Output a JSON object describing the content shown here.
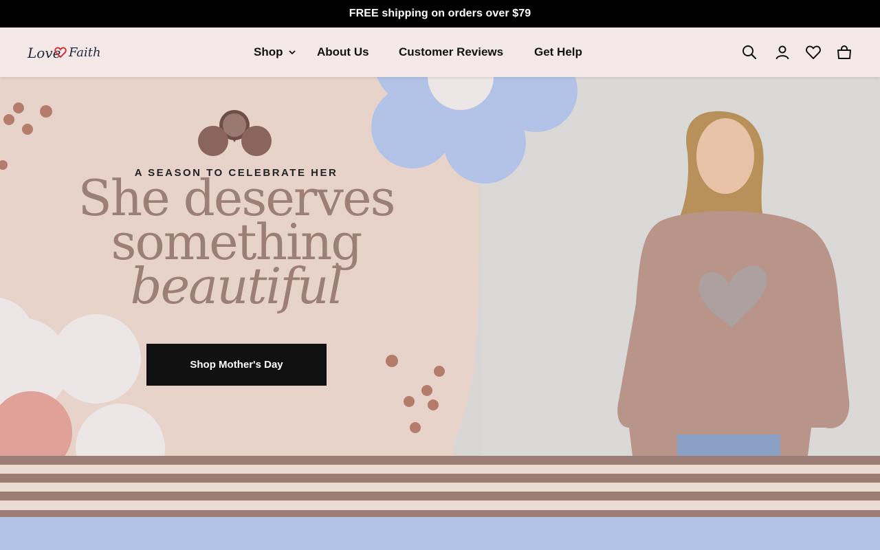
{
  "announcement": {
    "text": "FREE shipping on orders over $79"
  },
  "header": {
    "logo_text": "Love in Faith",
    "nav": [
      {
        "label": "Shop",
        "has_dropdown": true
      },
      {
        "label": "About Us"
      },
      {
        "label": "Customer Reviews"
      },
      {
        "label": "Get Help"
      }
    ],
    "icons": [
      "search-icon",
      "account-icon",
      "wishlist-icon",
      "cart-icon"
    ]
  },
  "hero": {
    "eyebrow": "A SEASON TO CELEBRATE HER",
    "headline_line1": "She deserves",
    "headline_line2": "something",
    "headline_line3": "beautiful",
    "cta_label": "Shop Mother's Day"
  },
  "colors": {
    "hero_bg": "#e8d3ca",
    "headline": "#9c8077",
    "flower_blue": "#b3c3e8",
    "flower_white": "#ece6e6",
    "flower_coral": "#e0a198",
    "stripe": "#9c7e76"
  }
}
